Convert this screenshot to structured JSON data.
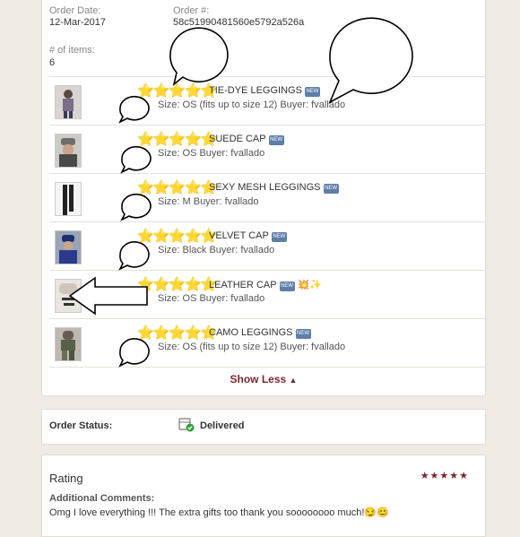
{
  "order": {
    "date_label": "Order Date:",
    "date_value": "12-Mar-2017",
    "number_label": "Order #:",
    "number_value": "58c51990481560e5792a526a",
    "items_label": "# of items:",
    "items_value": "6"
  },
  "items": [
    {
      "stars": "⭐⭐⭐⭐⭐",
      "title": "TIE-DYE LEGGINGS",
      "badge": "NEW",
      "extra": "",
      "sub": "Size: OS (fits up to size 12)  Buyer: fvallado"
    },
    {
      "stars": "⭐⭐⭐⭐⭐",
      "title": "SUEDE CAP",
      "badge": "NEW",
      "extra": "",
      "sub": "Size: OS  Buyer: fvallado"
    },
    {
      "stars": "⭐⭐⭐⭐⭐",
      "title": "SEXY MESH LEGGINGS",
      "badge": "NEW",
      "extra": "",
      "sub": "Size: M  Buyer: fvallado"
    },
    {
      "stars": "⭐⭐⭐⭐⭐",
      "title": "VELVET CAP",
      "badge": "NEW",
      "extra": "",
      "sub": "Size: Black  Buyer: fvallado"
    },
    {
      "stars": "⭐⭐⭐⭐⭐",
      "title": "LEATHER CAP",
      "badge": "NEW",
      "extra": "💥✨",
      "sub": "Size: OS  Buyer: fvallado"
    },
    {
      "stars": "⭐⭐⭐⭐⭐",
      "title": "CAMO LEGGINGS",
      "badge": "NEW",
      "extra": "",
      "sub": "Size: OS (fits up to size 12)  Buyer: fvallado"
    }
  ],
  "show_less_label": "Show Less",
  "status": {
    "label": "Order Status:",
    "value": "Delivered",
    "icon": "package-check-icon"
  },
  "rating": {
    "title": "Rating",
    "stars": "★★★★★",
    "comments_label": "Additional Comments:",
    "comments_text": "Omg I love everything !!! The extra gifts too thank you soooooooo much!😏😊"
  },
  "colors": {
    "accent": "#7a2630",
    "background": "#efeae3",
    "star": "#f5c518",
    "status_green": "#2e9e3e"
  }
}
